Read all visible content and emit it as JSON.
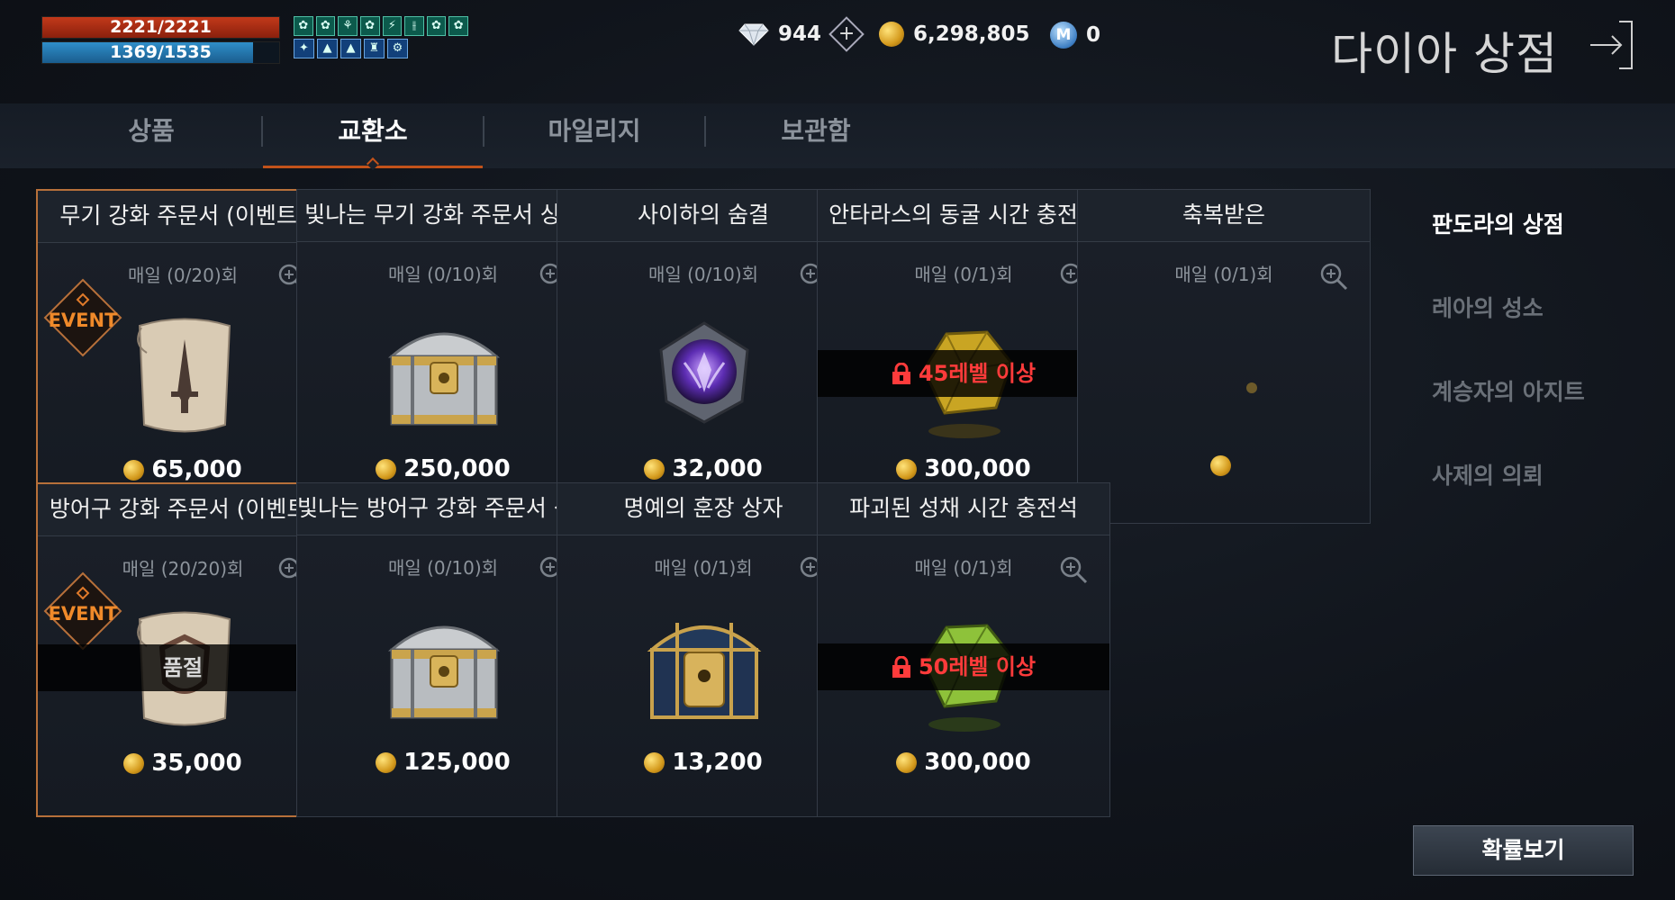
{
  "hud": {
    "hp_text": "2221/2221",
    "hp_fraction": 1.0,
    "mp_text": "1369/1535",
    "mp_fraction": 0.89,
    "buffs_row1": [
      "✿",
      "✿",
      "⚘",
      "✿",
      "⚡",
      "⫲",
      "✿",
      "✿"
    ],
    "buffs_row2": [
      "✦",
      "▲",
      "▲",
      "♜",
      "⚙"
    ]
  },
  "currency": {
    "diamond": "944",
    "gold": "6,298,805",
    "mileage_icon": "M",
    "mileage": "0"
  },
  "title": "다이아 상점",
  "tabs": [
    {
      "label": "상품"
    },
    {
      "label": "교환소"
    },
    {
      "label": "마일리지"
    },
    {
      "label": "보관함"
    }
  ],
  "active_tab": "교환소",
  "items": [
    {
      "name": "무기 강화 주문서 (이벤트)",
      "limit": "매일 (0/20)회",
      "price": "65,000",
      "event": true,
      "event_label": "EVENT",
      "item": "scroll-weapon"
    },
    {
      "name": "빛나는 무기 강화 주문서 상자",
      "limit": "매일 (0/10)회",
      "price": "250,000",
      "item": "silver-chest"
    },
    {
      "name": "사이하의 숨결",
      "limit": "매일 (0/10)회",
      "price": "32,000",
      "item": "purple-gem"
    },
    {
      "name": "안타라스의 동굴 시간 충전석",
      "limit": "매일 (0/1)회",
      "price": "300,000",
      "lock": "45레벨 이상",
      "item": "yellow-stone"
    },
    {
      "name": "축복받은",
      "limit": "매일 (0/1)회",
      "price": "",
      "item": "partial"
    },
    {
      "name": "방어구 강화 주문서 (이벤트)",
      "limit": "매일 (20/20)회",
      "price": "35,000",
      "event": true,
      "event_label": "EVENT",
      "soldout": "품절",
      "item": "scroll-armor"
    },
    {
      "name": "빛나는 방어구 강화 주문서 상자",
      "limit": "매일 (0/10)회",
      "price": "125,000",
      "item": "silver-chest"
    },
    {
      "name": "명예의 훈장 상자",
      "limit": "매일 (0/1)회",
      "price": "13,200",
      "item": "gold-chest"
    },
    {
      "name": "파괴된 성채 시간 충전석",
      "limit": "매일 (0/1)회",
      "price": "300,000",
      "lock": "50레벨 이상",
      "item": "green-stone"
    }
  ],
  "side_menu": [
    {
      "label": "판도라의 상점",
      "active": true
    },
    {
      "label": "레아의 성소"
    },
    {
      "label": "계승자의 아지트"
    },
    {
      "label": "사제의 의뢰"
    }
  ],
  "probability_button": "확률보기",
  "colors": {
    "accent": "#c2521a",
    "lock_text": "#ff3b3b",
    "event_border": "#b7703a"
  }
}
